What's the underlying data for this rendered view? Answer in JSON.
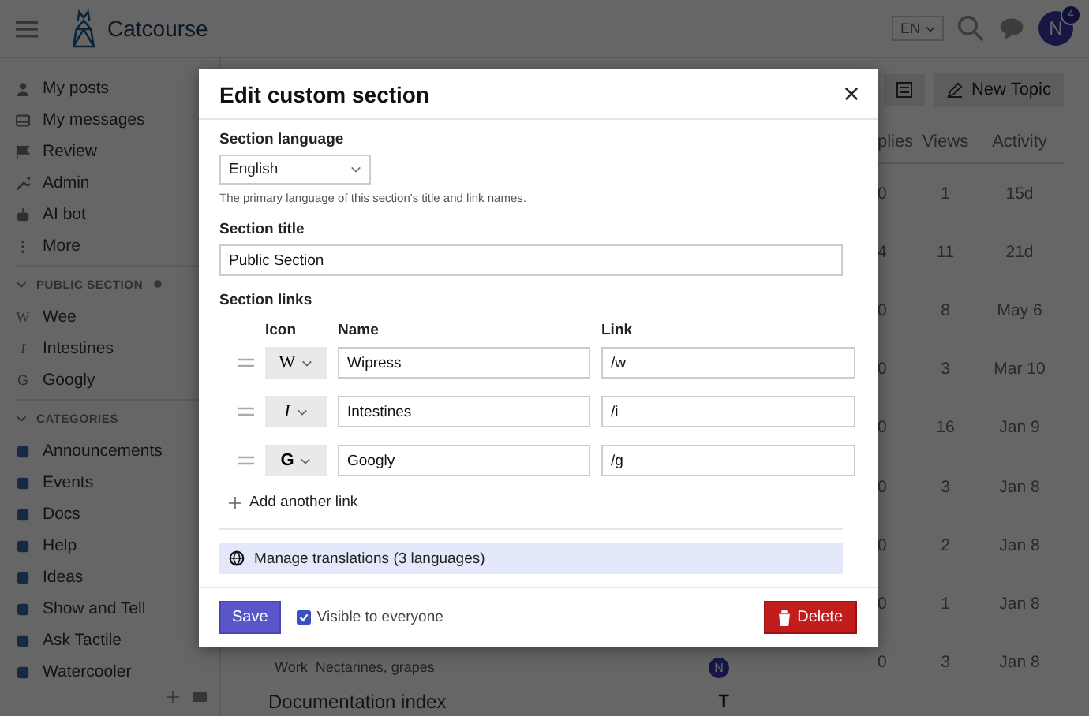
{
  "header": {
    "site_name": "Catcourse",
    "language": "EN",
    "avatar_letter": "N",
    "notification_count": "4"
  },
  "sidebar": {
    "items": [
      {
        "label": "My posts"
      },
      {
        "label": "My messages"
      },
      {
        "label": "Review"
      },
      {
        "label": "Admin"
      },
      {
        "label": "AI bot"
      },
      {
        "label": "More"
      }
    ],
    "sections": [
      {
        "title": "PUBLIC SECTION",
        "expanded": true,
        "public": true,
        "links": [
          {
            "label": "Wee",
            "glyph": "W",
            "kind": "serif"
          },
          {
            "label": "Intestines",
            "glyph": "I",
            "kind": "italic"
          },
          {
            "label": "Googly",
            "glyph": "G",
            "kind": "sans"
          }
        ]
      },
      {
        "title": "CATEGORIES",
        "expanded": true,
        "public": false,
        "links": [
          {
            "label": "Announcements"
          },
          {
            "label": "Events"
          },
          {
            "label": "Docs"
          },
          {
            "label": "Help"
          },
          {
            "label": "Ideas"
          },
          {
            "label": "Show and Tell"
          },
          {
            "label": "Ask Tactile"
          },
          {
            "label": "Watercooler"
          }
        ]
      }
    ]
  },
  "topics": {
    "new_topic": "New Topic",
    "columns": [
      "plies",
      "Views",
      "Activity"
    ],
    "rows": [
      {
        "replies": "0",
        "views": "1",
        "activity": "15d"
      },
      {
        "replies": "4",
        "views": "11",
        "activity": "21d"
      },
      {
        "replies": "0",
        "views": "8",
        "activity": "May 6"
      },
      {
        "replies": "0",
        "views": "3",
        "activity": "Mar 10"
      },
      {
        "replies": "0",
        "views": "16",
        "activity": "Jan 9"
      },
      {
        "replies": "0",
        "views": "3",
        "activity": "Jan 8"
      },
      {
        "replies": "0",
        "views": "2",
        "activity": "Jan 8"
      },
      {
        "replies": "0",
        "views": "1",
        "activity": "Jan 8"
      },
      {
        "replies": "0",
        "views": "3",
        "activity": "Jan 8"
      }
    ],
    "below_dialog": [
      {
        "tags": "Work  Nectarines, grapes",
        "poster": "N"
      },
      {
        "title": "Documentation index",
        "poster": "T"
      }
    ]
  },
  "dialog": {
    "title": "Edit custom section",
    "language_label": "Section language",
    "language": "English",
    "language_hint": "The primary language of this section's title and link names.",
    "title_label": "Section title",
    "title_value": "Public Section",
    "links_label": "Section links",
    "link_columns": [
      "Icon",
      "Name",
      "Link"
    ],
    "links": [
      {
        "glyph": "W",
        "kind": "serif",
        "name": "Wipress",
        "url": "/w"
      },
      {
        "glyph": "I",
        "kind": "italic",
        "name": "Intestines",
        "url": "/i"
      },
      {
        "glyph": "G",
        "kind": "bold",
        "name": "Googly",
        "url": "/g"
      }
    ],
    "add_link": "Add another link",
    "translations": "Manage translations (3 languages)",
    "save": "Save",
    "visible_label": "Visible to everyone",
    "visible": true,
    "delete": "Delete"
  }
}
